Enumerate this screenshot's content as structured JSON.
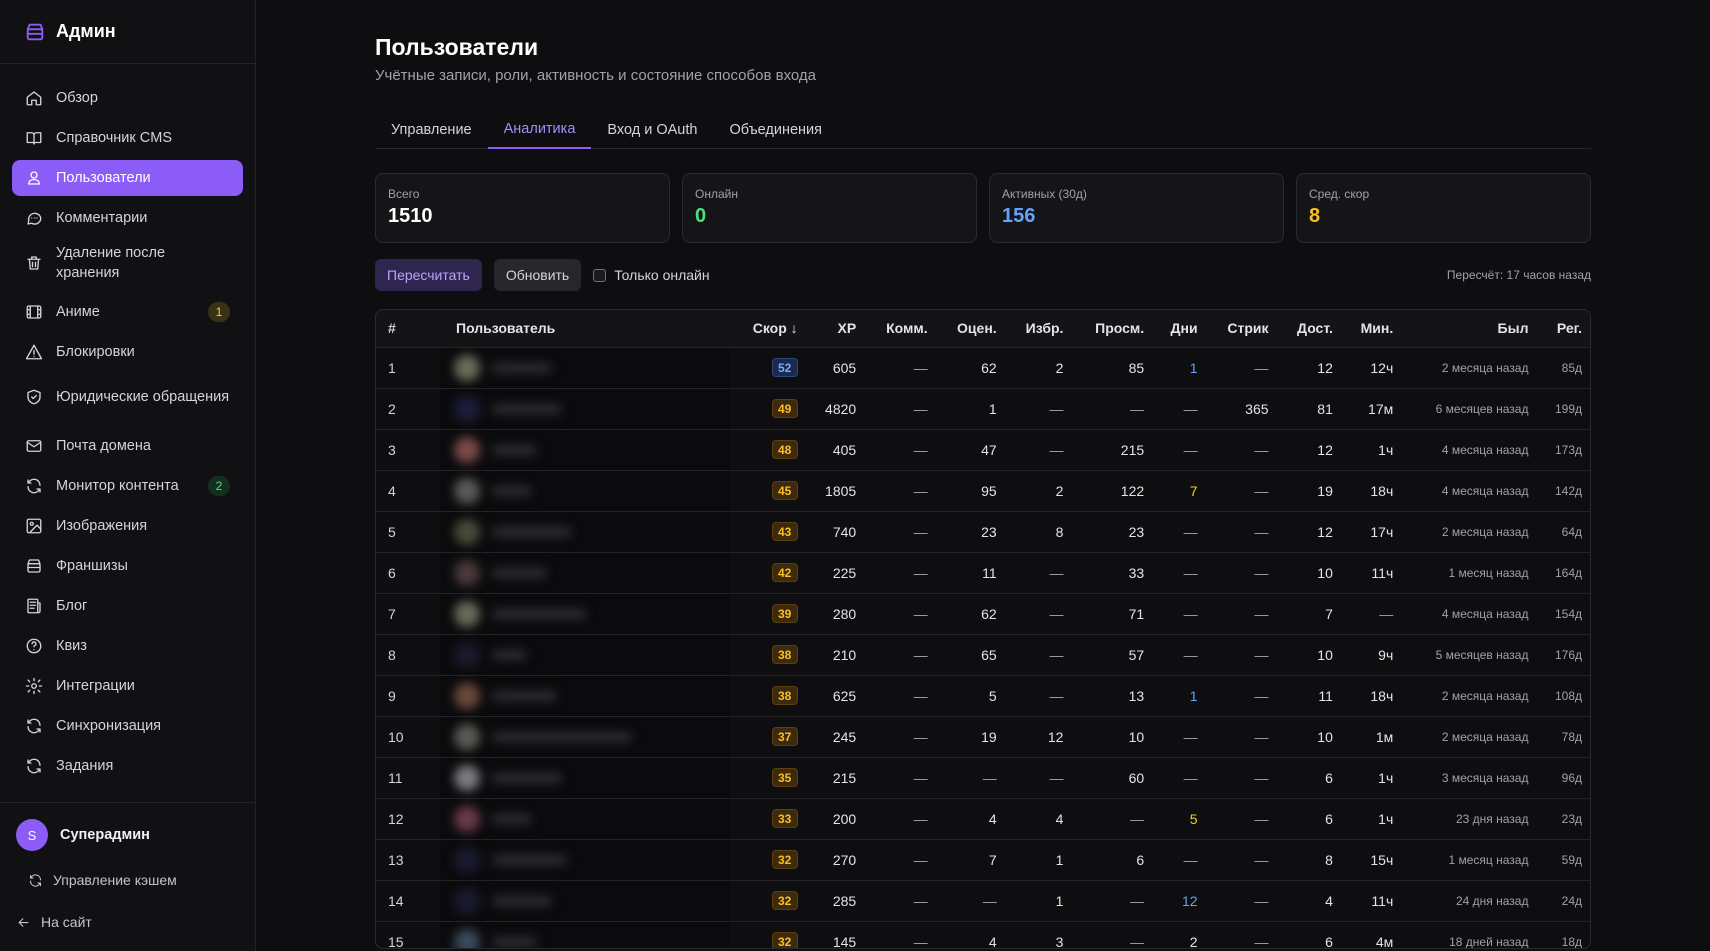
{
  "brand": {
    "title": "Админ"
  },
  "sidebar": {
    "items": [
      {
        "label": "Обзор",
        "icon": "home-icon",
        "active": false
      },
      {
        "label": "Справочник CMS",
        "icon": "book-icon",
        "active": false
      },
      {
        "label": "Пользователи",
        "icon": "users-icon",
        "active": true
      },
      {
        "label": "Комментарии",
        "icon": "comment-icon",
        "active": false
      },
      {
        "label": "Удаление после хранения",
        "icon": "trash-icon",
        "active": false
      },
      {
        "label": "Аниме",
        "icon": "film-icon",
        "active": false,
        "badge": "1",
        "badge_color": "yellow"
      },
      {
        "label": "Блокировки",
        "icon": "warning-icon",
        "active": false
      },
      {
        "label": "Юридические обращения",
        "icon": "shield-icon",
        "active": false
      },
      {
        "label": "Почта домена",
        "icon": "mail-icon",
        "active": false
      },
      {
        "label": "Монитор контента",
        "icon": "refresh-icon",
        "active": false,
        "badge": "2",
        "badge_color": "green"
      },
      {
        "label": "Изображения",
        "icon": "image-icon",
        "active": false
      },
      {
        "label": "Франшизы",
        "icon": "stack-icon",
        "active": false
      },
      {
        "label": "Блог",
        "icon": "newspaper-icon",
        "active": false
      },
      {
        "label": "Квиз",
        "icon": "help-circle-icon",
        "active": false
      },
      {
        "label": "Интеграции",
        "icon": "gear-icon",
        "active": false
      },
      {
        "label": "Синхронизация",
        "icon": "refresh-icon",
        "active": false
      },
      {
        "label": "Задания",
        "icon": "refresh-icon",
        "active": false
      }
    ],
    "user": {
      "initial": "S",
      "name": "Суперадмин"
    },
    "cache_link": "Управление кэшем",
    "site_link": "На сайт"
  },
  "header": {
    "title": "Пользователи",
    "subtitle": "Учётные записи, роли, активность и состояние способов входа"
  },
  "tabs": [
    {
      "label": "Управление",
      "active": false
    },
    {
      "label": "Аналитика",
      "active": true
    },
    {
      "label": "Вход и OAuth",
      "active": false
    },
    {
      "label": "Объединения",
      "active": false
    }
  ],
  "stats": [
    {
      "label": "Всего",
      "value": "1510",
      "color": "#ffffff"
    },
    {
      "label": "Онлайн",
      "value": "0",
      "color": "#4ade80"
    },
    {
      "label": "Активных (30д)",
      "value": "156",
      "color": "#60a5fa"
    },
    {
      "label": "Сред. скор",
      "value": "8",
      "color": "#fbbf24"
    }
  ],
  "toolbar": {
    "recalc_label": "Пересчитать",
    "refresh_label": "Обновить",
    "online_only_label": "Только онлайн",
    "recalc_info": "Пересчёт: 17 часов назад"
  },
  "table": {
    "columns": [
      "#",
      "Пользователь",
      "Скор ↓",
      "XP",
      "Комм.",
      "Оцен.",
      "Избр.",
      "Просм.",
      "Дни",
      "Стрик",
      "Дост.",
      "Мин.",
      "Был",
      "Рег."
    ],
    "rows": [
      {
        "n": "1",
        "score": "52",
        "score_color": "blue",
        "xp": "605",
        "comm": "—",
        "rate": "62",
        "fav": "2",
        "views": "85",
        "days": "1",
        "days_color": "blue",
        "streak": "—",
        "ach": "12",
        "min": "12ч",
        "last": "2 месяца назад",
        "reg": "85д",
        "av": "#6b6b5a",
        "w": 60
      },
      {
        "n": "2",
        "score": "49",
        "score_color": "orange",
        "xp": "4820",
        "comm": "—",
        "rate": "1",
        "fav": "—",
        "views": "—",
        "days": "—",
        "days_color": "",
        "streak": "365",
        "ach": "81",
        "min": "17м",
        "last": "6 месяцев назад",
        "reg": "199д",
        "av": "#1d1d3a",
        "w": 70
      },
      {
        "n": "3",
        "score": "48",
        "score_color": "orange",
        "xp": "405",
        "comm": "—",
        "rate": "47",
        "fav": "—",
        "views": "215",
        "days": "—",
        "days_color": "",
        "streak": "—",
        "ach": "12",
        "min": "1ч",
        "last": "4 месяца назад",
        "reg": "173д",
        "av": "#7a4a4a",
        "w": 45
      },
      {
        "n": "4",
        "score": "45",
        "score_color": "orange",
        "xp": "1805",
        "comm": "—",
        "rate": "95",
        "fav": "2",
        "views": "122",
        "days": "7",
        "days_color": "yellow",
        "streak": "—",
        "ach": "19",
        "min": "18ч",
        "last": "4 месяца назад",
        "reg": "142д",
        "av": "#5a5a5a",
        "w": 40
      },
      {
        "n": "5",
        "score": "43",
        "score_color": "orange",
        "xp": "740",
        "comm": "—",
        "rate": "23",
        "fav": "8",
        "views": "23",
        "days": "—",
        "days_color": "",
        "streak": "—",
        "ach": "12",
        "min": "17ч",
        "last": "2 месяца назад",
        "reg": "64д",
        "av": "#4a4a3a",
        "w": 80
      },
      {
        "n": "6",
        "score": "42",
        "score_color": "orange",
        "xp": "225",
        "comm": "—",
        "rate": "11",
        "fav": "—",
        "views": "33",
        "days": "—",
        "days_color": "",
        "streak": "—",
        "ach": "10",
        "min": "11ч",
        "last": "1 месяц назад",
        "reg": "164д",
        "av": "#4a3a3a",
        "w": 55
      },
      {
        "n": "7",
        "score": "39",
        "score_color": "orange",
        "xp": "280",
        "comm": "—",
        "rate": "62",
        "fav": "—",
        "views": "71",
        "days": "—",
        "days_color": "",
        "streak": "—",
        "ach": "7",
        "min": "—",
        "last": "4 месяца назад",
        "reg": "154д",
        "av": "#6a6a5a",
        "w": 95
      },
      {
        "n": "8",
        "score": "38",
        "score_color": "orange",
        "xp": "210",
        "comm": "—",
        "rate": "65",
        "fav": "—",
        "views": "57",
        "days": "—",
        "days_color": "",
        "streak": "—",
        "ach": "10",
        "min": "9ч",
        "last": "5 месяцев назад",
        "reg": "176д",
        "av": "#1a1a2a",
        "w": 35
      },
      {
        "n": "9",
        "score": "38",
        "score_color": "orange",
        "xp": "625",
        "comm": "—",
        "rate": "5",
        "fav": "—",
        "views": "13",
        "days": "1",
        "days_color": "blue",
        "streak": "—",
        "ach": "11",
        "min": "18ч",
        "last": "2 месяца назад",
        "reg": "108д",
        "av": "#6a4a3a",
        "w": 65
      },
      {
        "n": "10",
        "score": "37",
        "score_color": "orange",
        "xp": "245",
        "comm": "—",
        "rate": "19",
        "fav": "12",
        "views": "10",
        "days": "—",
        "days_color": "",
        "streak": "—",
        "ach": "10",
        "min": "1м",
        "last": "2 месяца назад",
        "reg": "78д",
        "av": "#5a5a55",
        "w": 140
      },
      {
        "n": "11",
        "score": "35",
        "score_color": "orange",
        "xp": "215",
        "comm": "—",
        "rate": "—",
        "fav": "—",
        "views": "60",
        "days": "—",
        "days_color": "",
        "streak": "—",
        "ach": "6",
        "min": "1ч",
        "last": "3 месяца назад",
        "reg": "96д",
        "av": "#7a7a80",
        "w": 70
      },
      {
        "n": "12",
        "score": "33",
        "score_color": "orange",
        "xp": "200",
        "comm": "—",
        "rate": "4",
        "fav": "4",
        "views": "—",
        "days": "5",
        "days_color": "yellow",
        "streak": "—",
        "ach": "6",
        "min": "1ч",
        "last": "23 дня назад",
        "reg": "23д",
        "av": "#6a3a4a",
        "w": 40
      },
      {
        "n": "13",
        "score": "32",
        "score_color": "orange",
        "xp": "270",
        "comm": "—",
        "rate": "7",
        "fav": "1",
        "views": "6",
        "days": "—",
        "days_color": "",
        "streak": "—",
        "ach": "8",
        "min": "15ч",
        "last": "1 месяц назад",
        "reg": "59д",
        "av": "#1a1a30",
        "w": 75
      },
      {
        "n": "14",
        "score": "32",
        "score_color": "orange",
        "xp": "285",
        "comm": "—",
        "rate": "—",
        "fav": "1",
        "views": "—",
        "days": "12",
        "days_color": "blue",
        "streak": "—",
        "ach": "4",
        "min": "11ч",
        "last": "24 дня назад",
        "reg": "24д",
        "av": "#1a1a30",
        "w": 60
      },
      {
        "n": "15",
        "score": "32",
        "score_color": "orange",
        "xp": "145",
        "comm": "—",
        "rate": "4",
        "fav": "3",
        "views": "—",
        "days": "2",
        "days_color": "",
        "streak": "—",
        "ach": "6",
        "min": "4м",
        "last": "18 дней назад",
        "reg": "18д",
        "av": "#3a4a5a",
        "w": 45
      }
    ]
  },
  "colors": {
    "accent": "#8b5cf6",
    "bg": "#0e0e10",
    "sidebar_bg": "#111114"
  }
}
